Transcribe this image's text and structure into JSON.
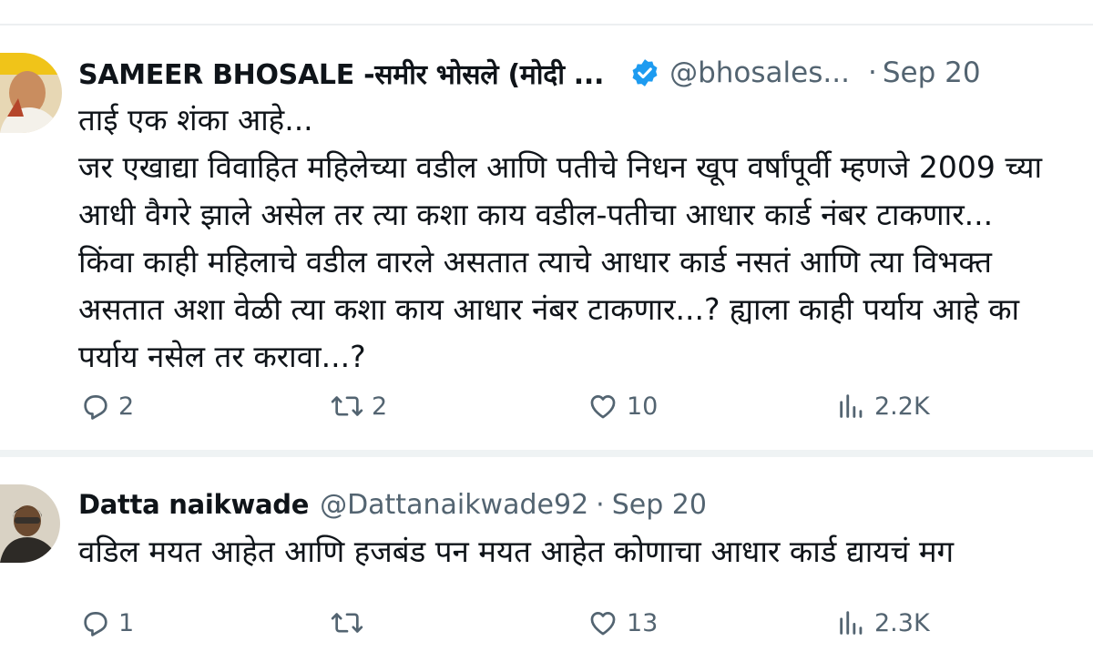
{
  "tweets": [
    {
      "display_name": "SAMEER BHOSALE -समीर भोसले (मोदी ...",
      "verified": true,
      "handle": "@bhosales...",
      "separator": "·",
      "date": "Sep 20",
      "text_lines": [
        "ताई एक शंका आहे...",
        "जर एखाद्या विवाहित महिलेच्या वडील आणि पतीचे निधन खूप वर्षांपूर्वी म्हणजे 2009 च्या",
        "आधी वैगरे झाले असेल तर त्या कशा काय वडील-पतीचा आधार कार्ड नंबर टाकणार...",
        "किंवा काही महिलाचे वडील वारले असतात त्याचे आधार कार्ड नसतं आणि त्या विभक्त",
        "असतात अशा वेळी त्या कशा काय आधार नंबर टाकणार...? ह्याला काही पर्याय आहे का",
        "पर्याय नसेल तर करावा...?"
      ],
      "actions": {
        "replies": "2",
        "retweets": "2",
        "likes": "10",
        "views": "2.2K"
      }
    },
    {
      "display_name": "Datta naikwade",
      "verified": false,
      "handle": "@Dattanaikwade92",
      "separator": "·",
      "date": "Sep 20",
      "text_lines": [
        "वडिल मयत आहेत आणि हजबंड पन मयत आहेत कोणाचा आधार कार्ड द्यायचं मग"
      ],
      "actions": {
        "replies": "1",
        "retweets": "",
        "likes": "13",
        "views": "2.3K"
      }
    }
  ],
  "icons": {
    "reply": "reply-icon",
    "retweet": "retweet-icon",
    "like": "heart-icon",
    "views": "views-icon",
    "verified": "verified-badge-icon"
  },
  "colors": {
    "verified_blue": "#1d9bf0",
    "secondary_text": "#536471",
    "primary_text": "#0f1419"
  }
}
